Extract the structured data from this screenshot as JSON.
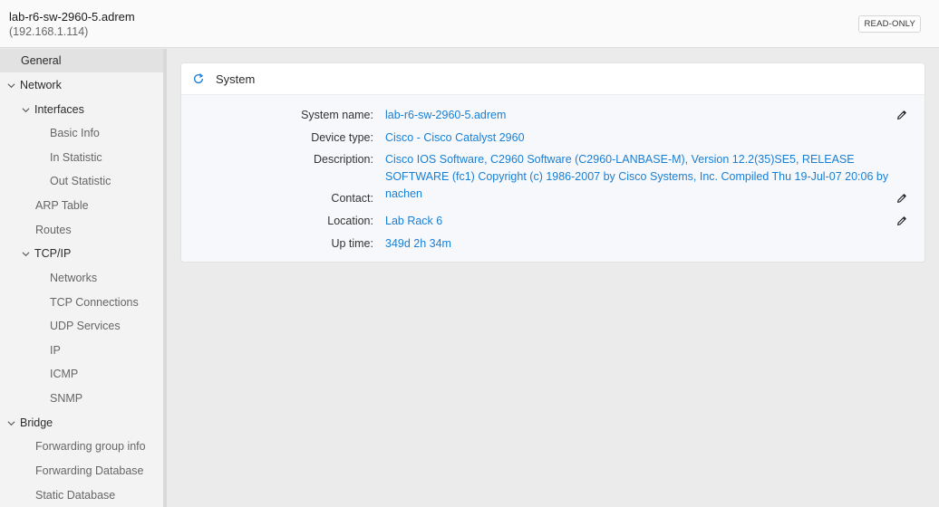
{
  "header": {
    "title": "lab-r6-sw-2960-5.adrem",
    "subtitle": "(192.168.1.114)",
    "badge": "READ-ONLY"
  },
  "sidebar": {
    "general": "General",
    "network": "Network",
    "interfaces": "Interfaces",
    "basic_info": "Basic Info",
    "in_statistic": "In Statistic",
    "out_statistic": "Out Statistic",
    "arp_table": "ARP Table",
    "routes": "Routes",
    "tcpip": "TCP/IP",
    "networks": "Networks",
    "tcp_connections": "TCP Connections",
    "udp_services": "UDP Services",
    "ip": "IP",
    "icmp": "ICMP",
    "snmp": "SNMP",
    "bridge": "Bridge",
    "forwarding_group_info": "Forwarding group info",
    "forwarding_database": "Forwarding Database",
    "static_database": "Static Database"
  },
  "system": {
    "title": "System",
    "system_name_label": "System name",
    "system_name": "lab-r6-sw-2960-5.adrem",
    "device_type_label": "Device type",
    "device_type": "Cisco - Cisco Catalyst 2960",
    "description_label": "Description",
    "description": "Cisco IOS Software, C2960 Software (C2960-LANBASE-M), Version 12.2(35)SE5, RELEASE SOFTWARE (fc1) Copyright (c) 1986-2007 by Cisco Systems, Inc. Compiled Thu 19-Jul-07 20:06 by nachen",
    "contact_label": "Contact",
    "contact": "",
    "location_label": "Location",
    "location": "Lab Rack 6",
    "uptime_label": "Up time",
    "uptime": "349d 2h 34m"
  },
  "colors": {
    "accent": "#1a7fd4",
    "sidebar_bg": "#f3f3f3",
    "selected_bg": "#e2e2e2"
  }
}
